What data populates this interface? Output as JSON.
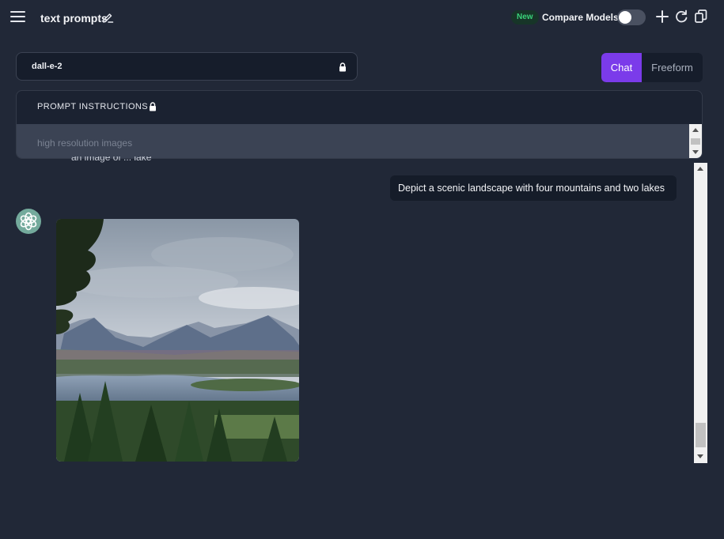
{
  "header": {
    "title": "text prompts",
    "new_badge": "New",
    "compare_label": "Compare Models",
    "compare_enabled": false
  },
  "model_select": {
    "value": "dall-e-2"
  },
  "mode_tabs": [
    {
      "label": "Chat",
      "active": true
    },
    {
      "label": "Freeform",
      "active": false
    }
  ],
  "prompt_instructions": {
    "title": "PROMPT INSTRUCTIONS",
    "placeholder": "high resolution images"
  },
  "chat": {
    "clipped_text": "an image of ... lake",
    "messages": [
      {
        "role": "user",
        "text": "Depict a scenic landscape with four mountains and two lakes"
      },
      {
        "role": "assistant",
        "content": "generated-image"
      }
    ]
  },
  "colors": {
    "background": "#212837",
    "accent": "#7b3bea",
    "new_badge": "#3ad27a",
    "avatar": "#74aa9c"
  },
  "icons": [
    "menu-icon",
    "edit-icon",
    "lock-icon",
    "plus-icon",
    "refresh-icon",
    "copy-icon",
    "openai-logo-icon"
  ]
}
